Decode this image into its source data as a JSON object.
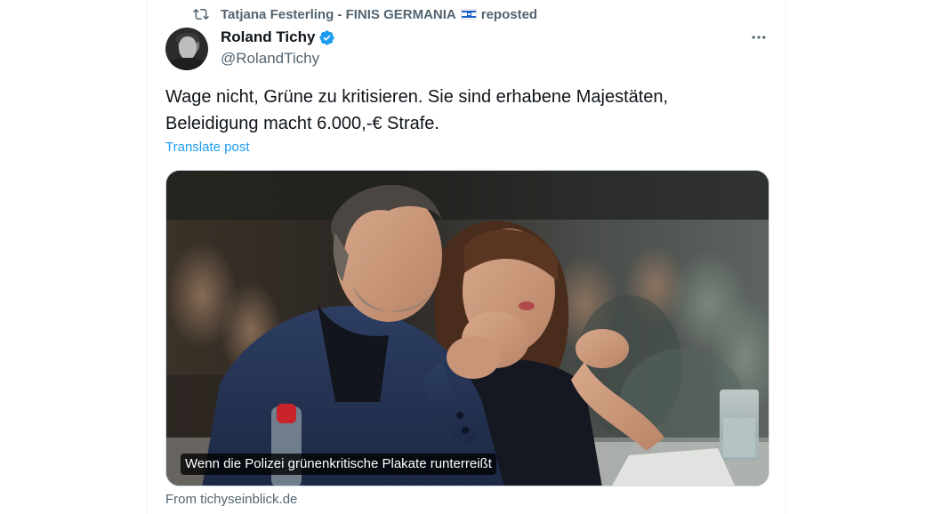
{
  "repost": {
    "name": "Tatjana Festerling - FINIS GERMANIA",
    "suffix": "reposted",
    "icon": "repost-icon",
    "flag": "israel-flag-emoji"
  },
  "author": {
    "name": "Roland Tichy",
    "handle": "@RolandTichy",
    "verified": true,
    "verified_color": "#1d9bf0"
  },
  "post": {
    "text_line_1": "Wage nicht, Grüne zu kritisieren. Sie sind erhabene Majestäten,",
    "text_line_2": "Beleidigung macht 6.000,-€ Strafe.",
    "translate_label": "Translate post"
  },
  "media": {
    "caption": "Wenn die Polizei grünenkritische Plakate runterreißt",
    "source": "From tichyseinblick.de"
  },
  "colors": {
    "text_primary": "#0f1419",
    "text_secondary": "#536471",
    "accent": "#1d9bf0"
  },
  "icons": {
    "more": "more-options-icon",
    "verified": "verified-badge-icon"
  }
}
